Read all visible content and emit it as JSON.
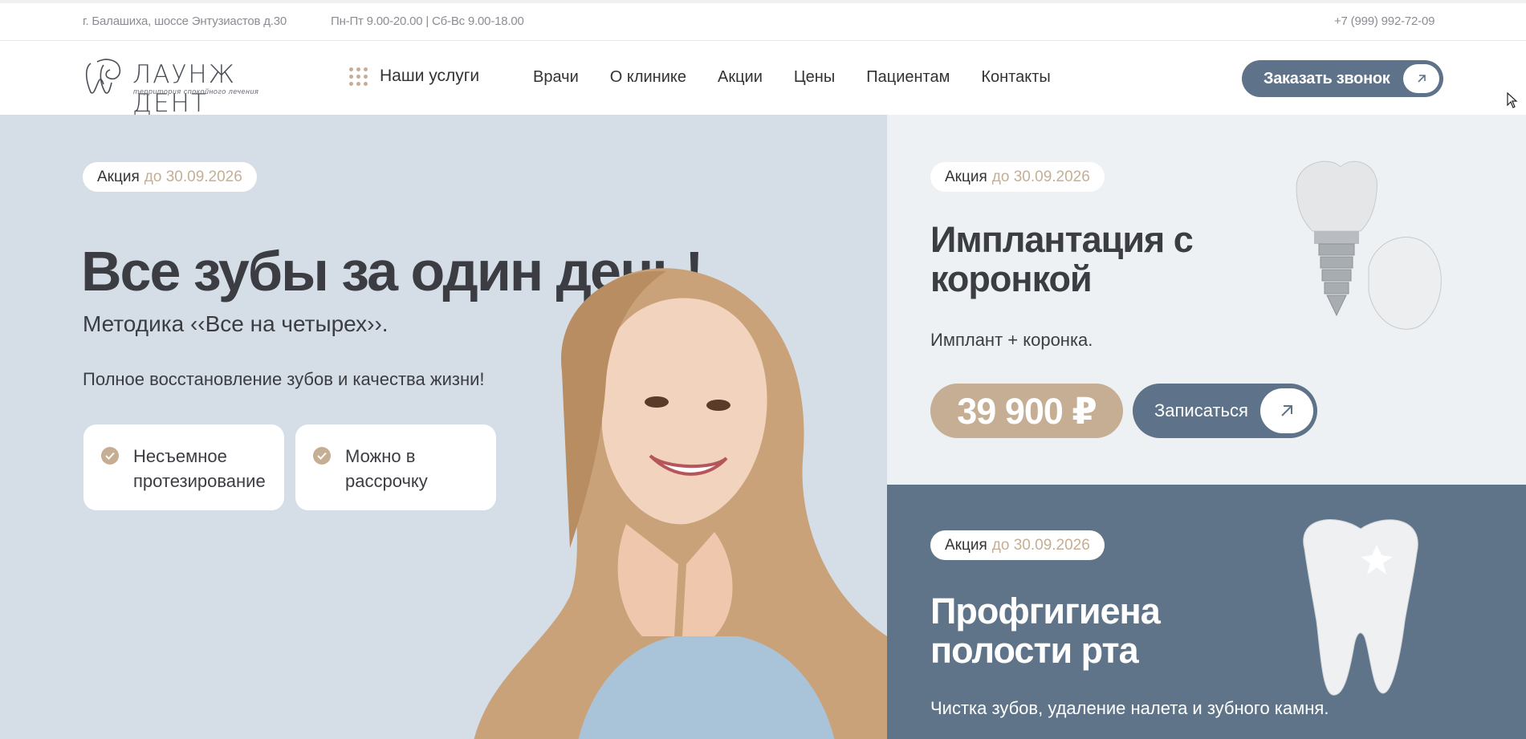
{
  "topbar": {
    "address": "г. Балашиха, шоссе Энтузиастов д.30",
    "hours": "Пн-Пт 9.00-20.00 | Сб-Вс 9.00-18.00",
    "phone": "+7 (999) 992-72-09"
  },
  "header": {
    "logo_text": "ЛАУНЖ ДЕНТ",
    "logo_tagline": "территория спокойного лечения",
    "services_label": "Наши услуги",
    "nav": [
      "Врачи",
      "О клинике",
      "Акции",
      "Цены",
      "Пациентам",
      "Контакты"
    ],
    "callback_label": "Заказать звонок"
  },
  "hero": {
    "badge_label": "Акция",
    "badge_date": "до 30.09.2026",
    "title": "Все зубы за один день!",
    "subtitle": "Методика ‹‹Все на четырех››.",
    "description": "Полное восстановление зубов и качества жизни!",
    "features": [
      "Несъемное протезирование",
      "Можно в рассрочку"
    ]
  },
  "promo_implant": {
    "badge_label": "Акция",
    "badge_date": "до 30.09.2026",
    "title_line1": "Имплантация с",
    "title_line2": "коронкой",
    "description": "Имплант + коронка.",
    "price": "39 900 ₽",
    "signup_label": "Записаться"
  },
  "promo_hygiene": {
    "badge_label": "Акция",
    "badge_date": "до 30.09.2026",
    "title_line1": "Профгигиена",
    "title_line2": "полости рта",
    "description": "Чистка зубов, удаление налета и зубного камня."
  },
  "colors": {
    "accent_beige": "#c5ae93",
    "accent_slate": "#5e7389",
    "hero_bg": "#d5dee6",
    "promo_light_bg": "#eef1f4",
    "text_dark": "#3b3d43"
  },
  "icons": [
    "grid-dots-icon",
    "arrow-up-right-icon",
    "check-circle-icon",
    "logo-tooth-icon",
    "mouse-cursor-icon"
  ]
}
